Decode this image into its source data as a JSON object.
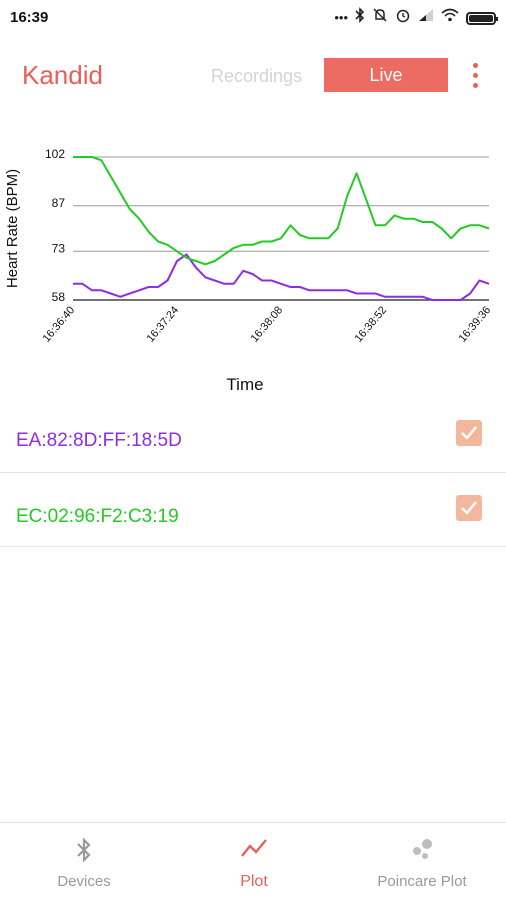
{
  "status_bar": {
    "time": "16:39",
    "icons": [
      "more-dots-icon",
      "bluetooth-icon",
      "muted-bell-icon",
      "alarm-icon",
      "signal-icon",
      "wifi-icon",
      "battery-icon"
    ]
  },
  "app_bar": {
    "title": "Kandid",
    "tabs": [
      {
        "label": "Recordings",
        "active": false
      },
      {
        "label": "Live",
        "active": true
      }
    ],
    "menu_icon": "more-vert-icon"
  },
  "chart_data": {
    "type": "line",
    "ylabel": "Heart Rate  (BPM)",
    "xlabel": "Time",
    "y_ticks": [
      "102",
      "87",
      "73",
      "58"
    ],
    "ylim": [
      58,
      102
    ],
    "x_ticks": [
      "16:36:40",
      "16:37:24",
      "16:38:08",
      "16:38:52",
      "16:39:36"
    ],
    "x_range_seconds": [
      0,
      176
    ],
    "grid": "horizontal",
    "series": [
      {
        "name": "EA:82:8D:FF:18:5D",
        "color": "#8e2de2",
        "x": [
          0,
          4,
          8,
          12,
          16,
          20,
          24,
          28,
          32,
          36,
          40,
          44,
          48,
          52,
          56,
          60,
          64,
          68,
          72,
          76,
          80,
          84,
          88,
          92,
          96,
          100,
          104,
          108,
          112,
          116,
          120,
          124,
          128,
          132,
          136,
          140,
          144,
          148,
          152,
          156,
          160,
          164,
          168,
          172,
          176
        ],
        "y": [
          63,
          63,
          61,
          61,
          60,
          59,
          60,
          61,
          62,
          62,
          64,
          70,
          72,
          68,
          65,
          64,
          63,
          63,
          67,
          66,
          64,
          64,
          63,
          62,
          62,
          61,
          61,
          61,
          61,
          61,
          60,
          60,
          60,
          59,
          59,
          59,
          59,
          59,
          58,
          58,
          58,
          58,
          60,
          64,
          63
        ]
      },
      {
        "name": "EC:02:96:F2:C3:19",
        "color": "#22cc22",
        "x": [
          0,
          4,
          8,
          12,
          16,
          20,
          24,
          28,
          32,
          36,
          40,
          44,
          48,
          52,
          56,
          60,
          64,
          68,
          72,
          76,
          80,
          84,
          88,
          92,
          96,
          100,
          104,
          108,
          112,
          116,
          120,
          124,
          128,
          132,
          136,
          140,
          144,
          148,
          152,
          156,
          160,
          164,
          168,
          172,
          176
        ],
        "y": [
          102,
          102,
          102,
          101,
          96,
          91,
          86,
          83,
          79,
          76,
          75,
          73,
          71,
          70,
          69,
          70,
          72,
          74,
          75,
          75,
          76,
          76,
          77,
          81,
          78,
          77,
          77,
          77,
          80,
          90,
          97,
          89,
          81,
          81,
          84,
          83,
          83,
          82,
          82,
          80,
          77,
          80,
          81,
          81,
          80
        ]
      }
    ]
  },
  "devices": [
    {
      "label": "EA:82:8D:FF:18:5D",
      "color": "#8e2de2",
      "checked": true
    },
    {
      "label": "EC:02:96:F2:C3:19",
      "color": "#22cc22",
      "checked": true
    }
  ],
  "bottom_nav": [
    {
      "label": "Devices",
      "icon": "bluetooth-icon",
      "active": false
    },
    {
      "label": "Plot",
      "icon": "line-chart-icon",
      "active": true
    },
    {
      "label": "Poincare Plot",
      "icon": "scatter-dots-icon",
      "active": false
    }
  ]
}
